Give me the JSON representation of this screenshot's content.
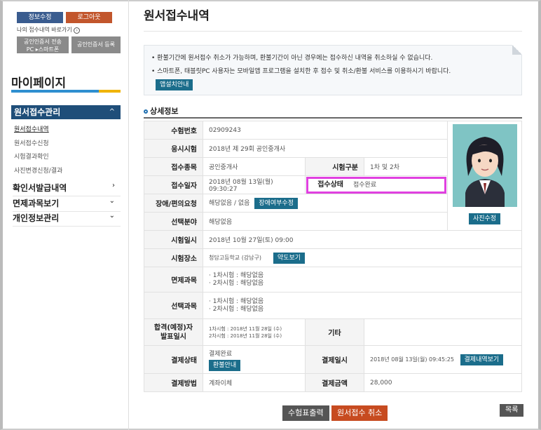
{
  "sidebar": {
    "edit_info": "정보수정",
    "logout": "로그아웃",
    "my_history_link": "나의 접수내역 바로가기",
    "cert_send": "공인인증서 전송",
    "cert_pc_phone": "PC ▸스마트폰",
    "cert_register": "공인인증서 등록",
    "mypage_title": "마이페이지",
    "menu": [
      {
        "label": "원서접수관리",
        "caret": "^"
      },
      {
        "label": "확인서발급내역",
        "caret": "›"
      },
      {
        "label": "면제과목보기",
        "caret": "⌄"
      },
      {
        "label": "개인정보관리",
        "caret": "⌄"
      }
    ],
    "submenu": [
      "원서접수내역",
      "원서접수신청",
      "시험결과확인",
      "사진변경신청/결과"
    ]
  },
  "page": {
    "title": "원서접수내역",
    "notice1": "환불기간에 원서접수 취소가 가능하며, 환불기간이 아닌 경우에는 접수하신 내역을 취소하실 수 없습니다.",
    "notice2": "스마트폰, 태블릿PC 사용자는 모바일앱 프로그램을 설치한 후 접수 및 취소/환불 서비스를 이용하시기 바랍니다.",
    "app_guide": "앱설치안내",
    "section": "상세정보"
  },
  "detail": {
    "exam_no_label": "수험번호",
    "exam_no": "02909243",
    "exam_label": "응시시험",
    "exam": "2018년 제 29회 공인중개사",
    "type_label": "접수종목",
    "type": "공인중개사",
    "exam_div_label": "시험구분",
    "exam_div": "1차 및 2차",
    "date_label": "접수일자",
    "date": "2018년 08월 13일(월) 09:30:27",
    "status_label": "접수상태",
    "status": "접수완료",
    "disability_label": "장애/편의요청",
    "disability": "해당없음 / 없음",
    "disability_btn": "장애여부수정",
    "elective_label": "선택분야",
    "elective": "해당없음",
    "exam_date_label": "시험일시",
    "exam_date": "2018년 10월 27일(토) 09:00",
    "place_label": "시험장소",
    "place": "청담고등학교 (강남구)",
    "map_btn": "약도보기",
    "exempt_label": "면제과목",
    "exempt1": "· 1차시험 : 해당없음",
    "exempt2": "· 2차시험 : 해당없음",
    "choice_label": "선택과목",
    "choice1": "· 1차시험 : 해당없음",
    "choice2": "· 2차시험 : 해당없음",
    "pass_label": "합격(예정)자 발표일시",
    "pass1": "1차시험 : 2018년 11월 28일 (수)",
    "pass2": "2차시험 : 2018년 11월 28일 (수)",
    "etc_label": "기타",
    "pay_status_label": "결제상태",
    "pay_status": "결제완료",
    "refund_btn": "환불안내",
    "pay_date_label": "결제일시",
    "pay_date": "2018년 08월 13일(월) 09:45:25",
    "pay_detail_btn": "결제내역보기",
    "pay_method_label": "결제방법",
    "pay_method": "계좌이체",
    "amount_label": "결제금액",
    "amount": "28,000",
    "photo_edit": "사진수정"
  },
  "actions": {
    "print_ticket": "수험표출력",
    "cancel": "원서접수 취소",
    "list": "목록"
  },
  "colors": {
    "accent": "#1f4e79",
    "highlight": "#e040e0",
    "teal": "#1b6d8b"
  }
}
